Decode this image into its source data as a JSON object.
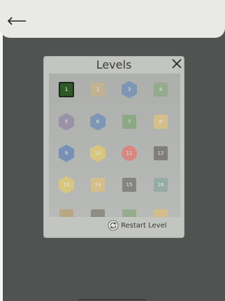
{
  "header": {
    "back_icon": "arrow-left-icon"
  },
  "modal": {
    "title": "Levels",
    "close_icon": "close-icon",
    "restart_label": "Restart Level",
    "restart_icon": "restart-icon"
  },
  "levels": [
    {
      "label": "1",
      "shape": "square-current",
      "color": "#2e5a27"
    },
    {
      "label": "2",
      "shape": "square",
      "color": "#c1b38f"
    },
    {
      "label": "3",
      "shape": "hexagon",
      "color": "#7d96b4"
    },
    {
      "label": "4",
      "shape": "square",
      "color": "#95ab8e"
    },
    {
      "label": "5",
      "shape": "hexagon",
      "color": "#9a93a7"
    },
    {
      "label": "6",
      "shape": "hexagon",
      "color": "#7d96b4"
    },
    {
      "label": "7",
      "shape": "square",
      "color": "#8ba985"
    },
    {
      "label": "8",
      "shape": "square",
      "color": "#d4bf8a"
    },
    {
      "label": "9",
      "shape": "hexagon",
      "color": "#7890b6"
    },
    {
      "label": "10",
      "shape": "hexagon",
      "color": "#d8c67f"
    },
    {
      "label": "11",
      "shape": "circle",
      "color": "#d88880"
    },
    {
      "label": "12",
      "shape": "square",
      "color": "#7f7e7b"
    },
    {
      "label": "13",
      "shape": "hexagon",
      "color": "#d8c67f"
    },
    {
      "label": "14",
      "shape": "square",
      "color": "#d4bf8a"
    },
    {
      "label": "15",
      "shape": "square",
      "color": "#858480"
    },
    {
      "label": "16",
      "shape": "square",
      "color": "#95aba4"
    },
    {
      "label": "",
      "shape": "square",
      "color": "#b9a784"
    },
    {
      "label": "",
      "shape": "square",
      "color": "#8f8d86"
    },
    {
      "label": "",
      "shape": "square",
      "color": "#96ac8d"
    },
    {
      "label": "",
      "shape": "square",
      "color": "#d4bf8a"
    }
  ]
}
